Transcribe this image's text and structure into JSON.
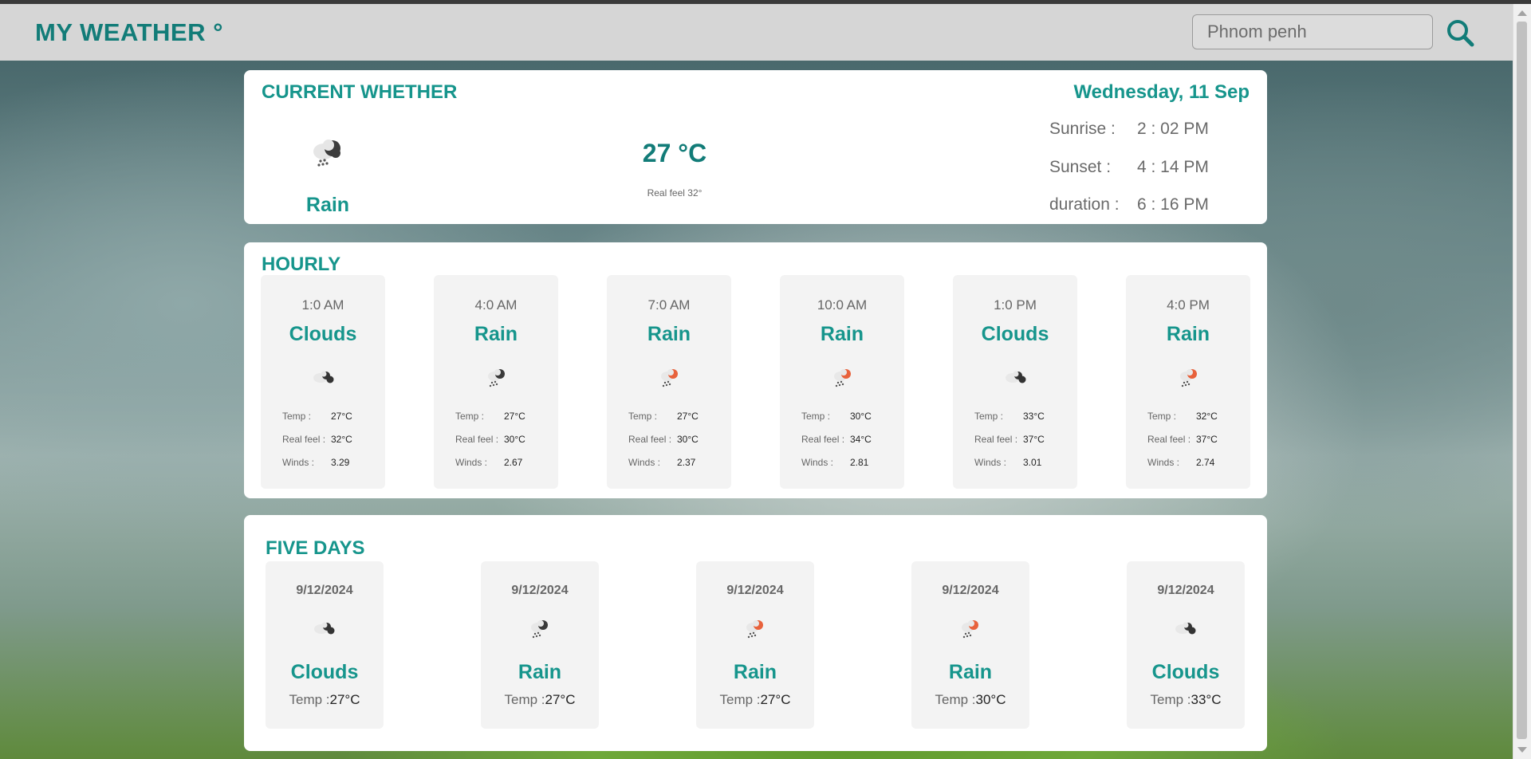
{
  "header": {
    "logo": "MY WEATHER °",
    "search_placeholder": "Phnom penh"
  },
  "current": {
    "title": "CURRENT WHETHER",
    "date": "Wednesday, 11 Sep",
    "condition": "Rain",
    "icon": "rain-icon",
    "temp": "27 °C",
    "real_feel": "Real feel 32°",
    "sunrise_label": "Sunrise :",
    "sunrise": "2 : 02 PM",
    "sunset_label": "Sunset :",
    "sunset": "4 : 14 PM",
    "duration_label": "duration :",
    "duration": "6 : 16 PM"
  },
  "hourly": {
    "title": "HOURLY",
    "temp_label": "Temp :",
    "realfeel_label": "Real feel :",
    "winds_label": "Winds :",
    "items": [
      {
        "time": "1:0 AM",
        "condition": "Clouds",
        "icon": "clouds-icon",
        "temp": "27°C",
        "real_feel": "32°C",
        "winds": "3.29"
      },
      {
        "time": "4:0 AM",
        "condition": "Rain",
        "icon": "rain-icon",
        "temp": "27°C",
        "real_feel": "30°C",
        "winds": "2.67"
      },
      {
        "time": "7:0 AM",
        "condition": "Rain",
        "icon": "sun-rain-icon",
        "temp": "27°C",
        "real_feel": "30°C",
        "winds": "2.37"
      },
      {
        "time": "10:0 AM",
        "condition": "Rain",
        "icon": "sun-rain-icon",
        "temp": "30°C",
        "real_feel": "34°C",
        "winds": "2.81"
      },
      {
        "time": "1:0 PM",
        "condition": "Clouds",
        "icon": "clouds-icon",
        "temp": "33°C",
        "real_feel": "37°C",
        "winds": "3.01"
      },
      {
        "time": "4:0 PM",
        "condition": "Rain",
        "icon": "sun-rain-icon",
        "temp": "32°C",
        "real_feel": "37°C",
        "winds": "2.74"
      }
    ]
  },
  "five_days": {
    "title": "FIVE DAYS",
    "temp_label": "Temp :",
    "items": [
      {
        "date": "9/12/2024",
        "condition": "Clouds",
        "icon": "clouds-icon",
        "temp": "27°C"
      },
      {
        "date": "9/12/2024",
        "condition": "Rain",
        "icon": "rain-icon",
        "temp": "27°C"
      },
      {
        "date": "9/12/2024",
        "condition": "Rain",
        "icon": "sun-rain-icon",
        "temp": "27°C"
      },
      {
        "date": "9/12/2024",
        "condition": "Rain",
        "icon": "sun-rain-icon",
        "temp": "30°C"
      },
      {
        "date": "9/12/2024",
        "condition": "Clouds",
        "icon": "clouds-icon",
        "temp": "33°C"
      }
    ]
  },
  "colors": {
    "teal": "#16958c",
    "teal_dark": "#127c78",
    "header_bg": "#d6d6d6",
    "card_bg": "#ffffff",
    "tile_bg": "#f3f3f3",
    "sun_orange": "#e8623c"
  }
}
